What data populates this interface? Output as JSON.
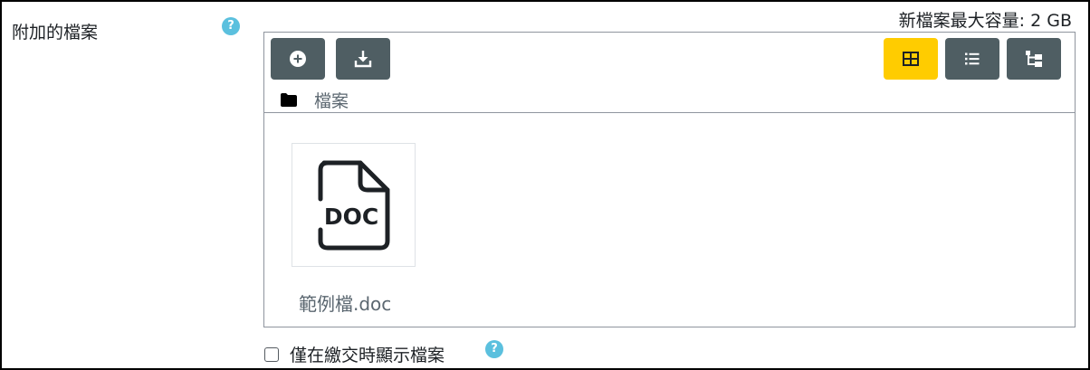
{
  "field": {
    "label": "附加的檔案",
    "help_icon": "?",
    "max_size": "新檔案最大容量: 2 GB"
  },
  "toolbar": {
    "add_icon": "plus-circle-icon",
    "download_icon": "download-icon",
    "views": [
      {
        "name": "grid-view",
        "icon": "grid-icon",
        "active": true
      },
      {
        "name": "list-view",
        "icon": "list-icon",
        "active": false
      },
      {
        "name": "tree-view",
        "icon": "tree-icon",
        "active": false
      }
    ]
  },
  "path": {
    "folder_icon": "folder-icon",
    "label": "檔案"
  },
  "files": [
    {
      "name": "範例檔.doc",
      "icon": "doc-file-icon",
      "icon_text": "DOC"
    }
  ],
  "option": {
    "checked": false,
    "label": "僅在繳交時顯示檔案",
    "help_icon": "?"
  },
  "colors": {
    "toolbar_button": "#4f5e63",
    "active_view": "#ffcc00",
    "help_icon": "#5bc0de",
    "border": "#8f959e"
  }
}
